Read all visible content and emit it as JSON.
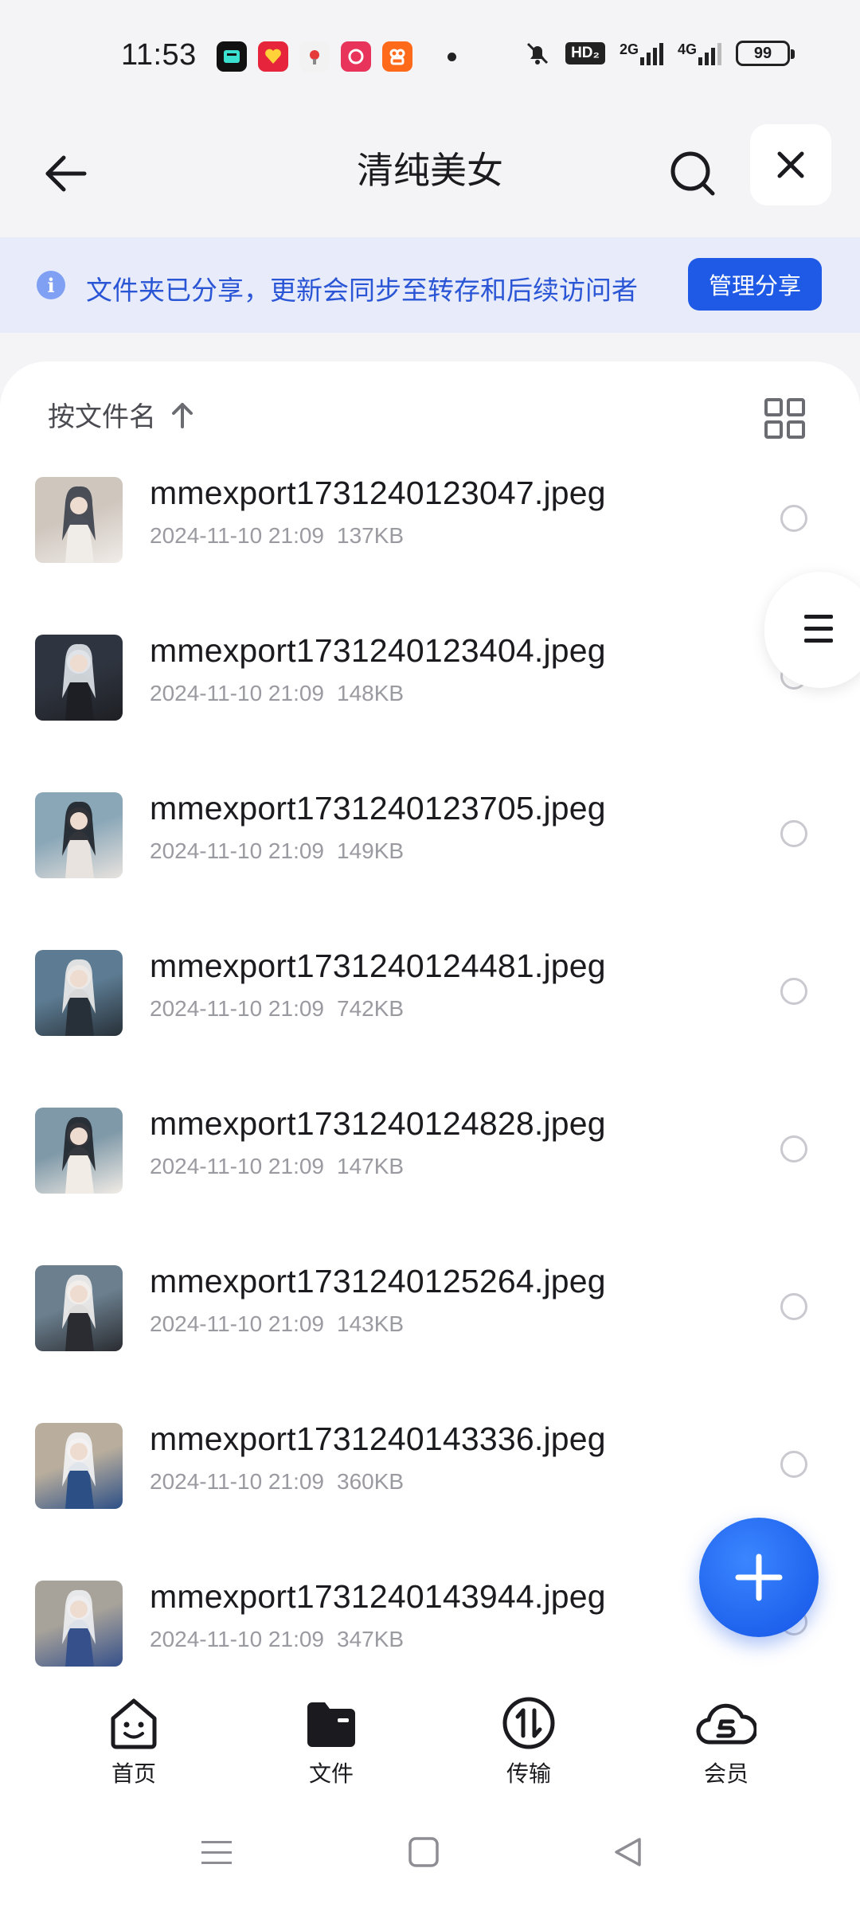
{
  "status_bar": {
    "time": "11:53",
    "app_icons": [
      {
        "name": "app-icon-1",
        "color": "#111111"
      },
      {
        "name": "app-icon-2",
        "color": "#e6243b"
      },
      {
        "name": "app-icon-3",
        "color": "#f2f2f2"
      },
      {
        "name": "app-icon-4",
        "color": "#e8345a"
      },
      {
        "name": "app-icon-5",
        "color": "#ff6a1a"
      }
    ],
    "hd_badge": "HD₂",
    "net_2g": "2G",
    "net_4g": "4G",
    "battery": "99"
  },
  "header": {
    "title": "清纯美女"
  },
  "banner": {
    "text": "文件夹已分享，更新会同步至转存和后续访问者",
    "button_label": "管理分享"
  },
  "sort": {
    "label": "按文件名"
  },
  "files": [
    {
      "name": "mmexport1731240123047.jpeg",
      "date": "2024-11-10 21:09",
      "size": "137KB",
      "thumb_colors": [
        "#cfc6be",
        "#3a3f4a",
        "#f0ece8"
      ]
    },
    {
      "name": "mmexport1731240123404.jpeg",
      "date": "2024-11-10 21:09",
      "size": "148KB",
      "thumb_colors": [
        "#2f3540",
        "#dfe4ea",
        "#1e1f24"
      ]
    },
    {
      "name": "mmexport1731240123705.jpeg",
      "date": "2024-11-10 21:09",
      "size": "149KB",
      "thumb_colors": [
        "#8aa7b8",
        "#1d2128",
        "#e8e3de"
      ]
    },
    {
      "name": "mmexport1731240124481.jpeg",
      "date": "2024-11-10 21:09",
      "size": "742KB",
      "thumb_colors": [
        "#5d7c93",
        "#ecebea",
        "#273038"
      ]
    },
    {
      "name": "mmexport1731240124828.jpeg",
      "date": "2024-11-10 21:09",
      "size": "147KB",
      "thumb_colors": [
        "#7f99a8",
        "#1f232a",
        "#f1ece6"
      ]
    },
    {
      "name": "mmexport1731240125264.jpeg",
      "date": "2024-11-10 21:09",
      "size": "143KB",
      "thumb_colors": [
        "#6b7f8e",
        "#f3f1ef",
        "#2a2c31"
      ]
    },
    {
      "name": "mmexport1731240143336.jpeg",
      "date": "2024-11-10 21:09",
      "size": "360KB",
      "thumb_colors": [
        "#b9ae9d",
        "#f4f4f6",
        "#2c4f86"
      ]
    },
    {
      "name": "mmexport1731240143944.jpeg",
      "date": "2024-11-10 21:09",
      "size": "347KB",
      "thumb_colors": [
        "#a7a29a",
        "#eef0f3",
        "#35508a"
      ]
    }
  ],
  "bottom_nav": {
    "items": [
      {
        "label": "首页",
        "icon": "home-face-icon"
      },
      {
        "label": "文件",
        "icon": "folder-icon"
      },
      {
        "label": "传输",
        "icon": "transfer-icon"
      },
      {
        "label": "会员",
        "icon": "vip-cloud-icon"
      }
    ]
  },
  "colors": {
    "accent": "#1f5ae6",
    "banner_bg": "#e7ebfa",
    "banner_text": "#2a56d6"
  }
}
